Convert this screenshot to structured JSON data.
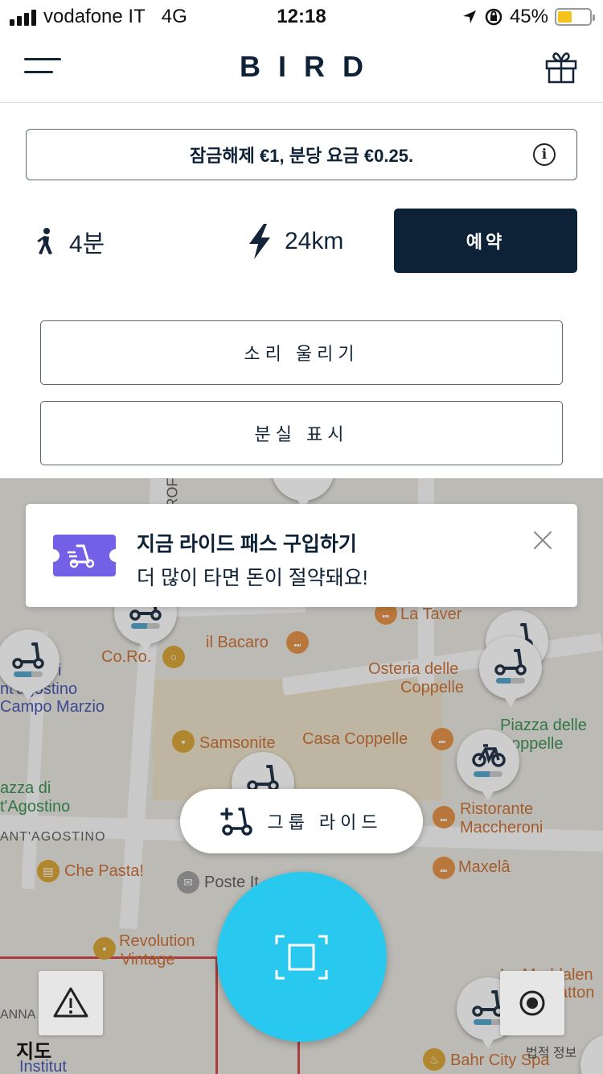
{
  "status_bar": {
    "carrier": "vodafone IT",
    "network": "4G",
    "time": "12:18",
    "battery": "45%",
    "battery_level": 0.45
  },
  "header": {
    "logo": "BIRD",
    "menu_icon": "hamburger-icon",
    "gift_icon": "gift-icon"
  },
  "pricing": {
    "text": "잠금해제 €1, 분당 요금 €0.25.",
    "info_icon": "info-icon"
  },
  "vehicle": {
    "walk_time": "4분",
    "range": "24km",
    "reserve_label": "예약"
  },
  "actions": {
    "ring_label": "소리 울리기",
    "report_missing_label": "분실 표시"
  },
  "pass_banner": {
    "title": "지금 라이드 패스 구입하기",
    "subtitle": "더 많이 타면 돈이 절약돼요!"
  },
  "group_ride": {
    "label": "그룹 라이드"
  },
  "map": {
    "labels": {
      "la_taverna": "La Taver",
      "il_bacaro": "il Bacaro",
      "coro": "Co.Ro.",
      "osteria1": "Osteria delle",
      "osteria2": "Coppelle",
      "agostino1": "i",
      "agostino2": "nt'agostino",
      "campo_marzio": "Campo Marzio",
      "piazza1": "Piazza delle",
      "piazza2": "oppelle",
      "samsonite": "Samsonite",
      "casa_coppelle": "Casa Coppelle",
      "piazza_di1": "azza di",
      "piazza_di2": "t'Agostino",
      "ristorante1": "Ristorante",
      "ristorante2": "Maccheroni",
      "via": "ANT'AGOSTINO",
      "che_pasta": "Che Pasta!",
      "poste": "Poste It",
      "maxela": "Maxelâ",
      "revolution1": "Revolution",
      "revolution2": "Vintage",
      "maddalena1": "La Maddalen",
      "maddalena2": "Statton",
      "anna": "ANNA",
      "institut": "Institut",
      "bahr": "Bahr City Spa",
      "rof": "ROF"
    },
    "maps_credit": "지도",
    "legal": "법적 정보",
    "accent_color": "#28c8ef",
    "scooter_battery_levels": [
      0.6,
      0.55,
      0.5,
      0.55,
      0.7,
      0.6,
      0.45
    ]
  }
}
